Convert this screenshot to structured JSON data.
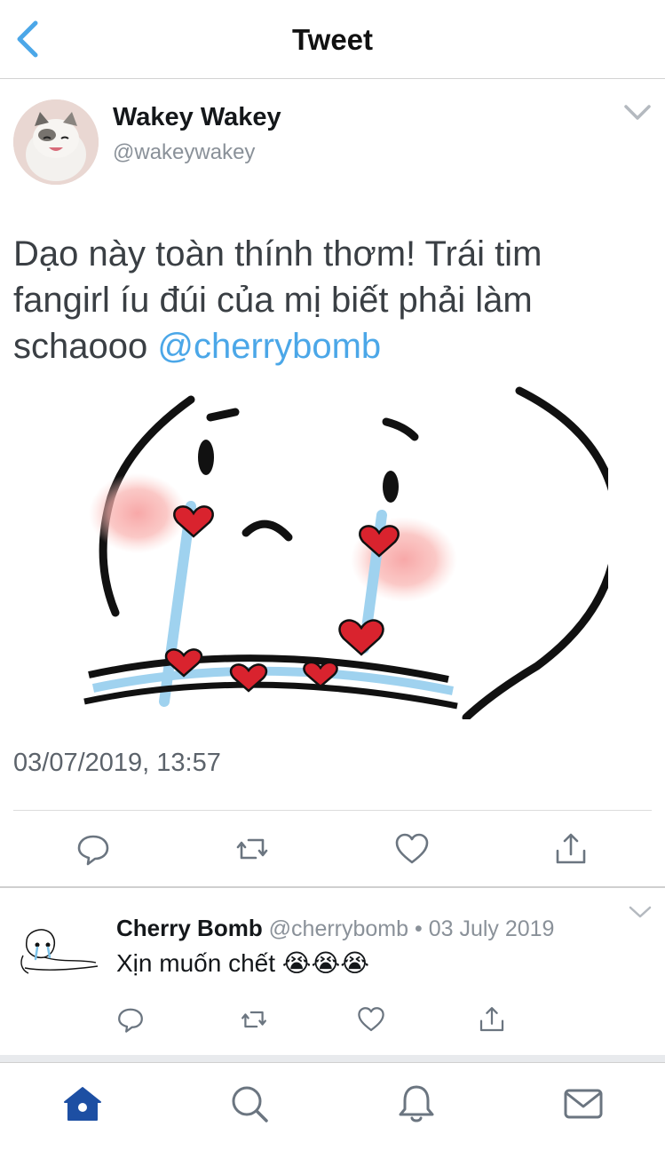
{
  "header": {
    "title": "Tweet"
  },
  "tweet": {
    "author_name": "Wakey Wakey",
    "author_handle": "@wakeywakey",
    "text": "Dạo này toàn thính thơm! Trái tim fangirl íu đúi của mị biết phải làm schaooo ",
    "mention": "@cherrybomb",
    "timestamp": "03/07/2019, 13:57"
  },
  "reply": {
    "author_name": "Cherry Bomb",
    "author_handle": "@cherrybomb",
    "separator": " • ",
    "date": "03 July 2019",
    "text": "Xịn muốn chết",
    "emoji": "😭😭😭"
  },
  "icons": {
    "back": "chevron-left-icon",
    "caret": "chevron-down-icon",
    "actions": [
      "reply-icon",
      "retweet-icon",
      "like-icon",
      "share-icon"
    ],
    "tabs": [
      "home-icon",
      "search-icon",
      "notifications-icon",
      "messages-icon"
    ]
  },
  "colors": {
    "accent": "#4ba7e8",
    "tab_active": "#1d4fa3",
    "icon_grey": "#6b7580"
  }
}
